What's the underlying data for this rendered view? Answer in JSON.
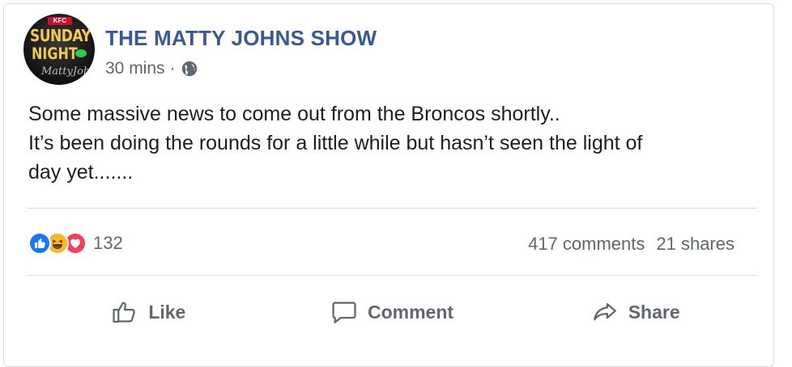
{
  "post": {
    "page_name": "THE MATTY JOHNS SHOW",
    "avatar_text": {
      "brand": "KFC",
      "line1": "SUNDAY",
      "line2": "NIGHT",
      "signature": "MattyJohns"
    },
    "time": "30 mins",
    "separator": "·",
    "privacy_icon": "globe-icon",
    "text_lines": [
      "Some massive news to come out from the Broncos shortly..",
      "It’s been doing the rounds for a little while but hasn’t seen the light of",
      "day yet......."
    ]
  },
  "engagement": {
    "reaction_icons": [
      "like-reaction-icon",
      "haha-reaction-icon",
      "love-reaction-icon"
    ],
    "reaction_count": "132",
    "comments": "417 comments",
    "shares": "21 shares"
  },
  "actions": {
    "like_label": "Like",
    "comment_label": "Comment",
    "share_label": "Share"
  },
  "colors": {
    "page_name": "#385898",
    "secondary_text": "#606770",
    "like_blue": "#1877f2",
    "love_red": "#f33e58",
    "haha_yellow": "#f7b928"
  }
}
